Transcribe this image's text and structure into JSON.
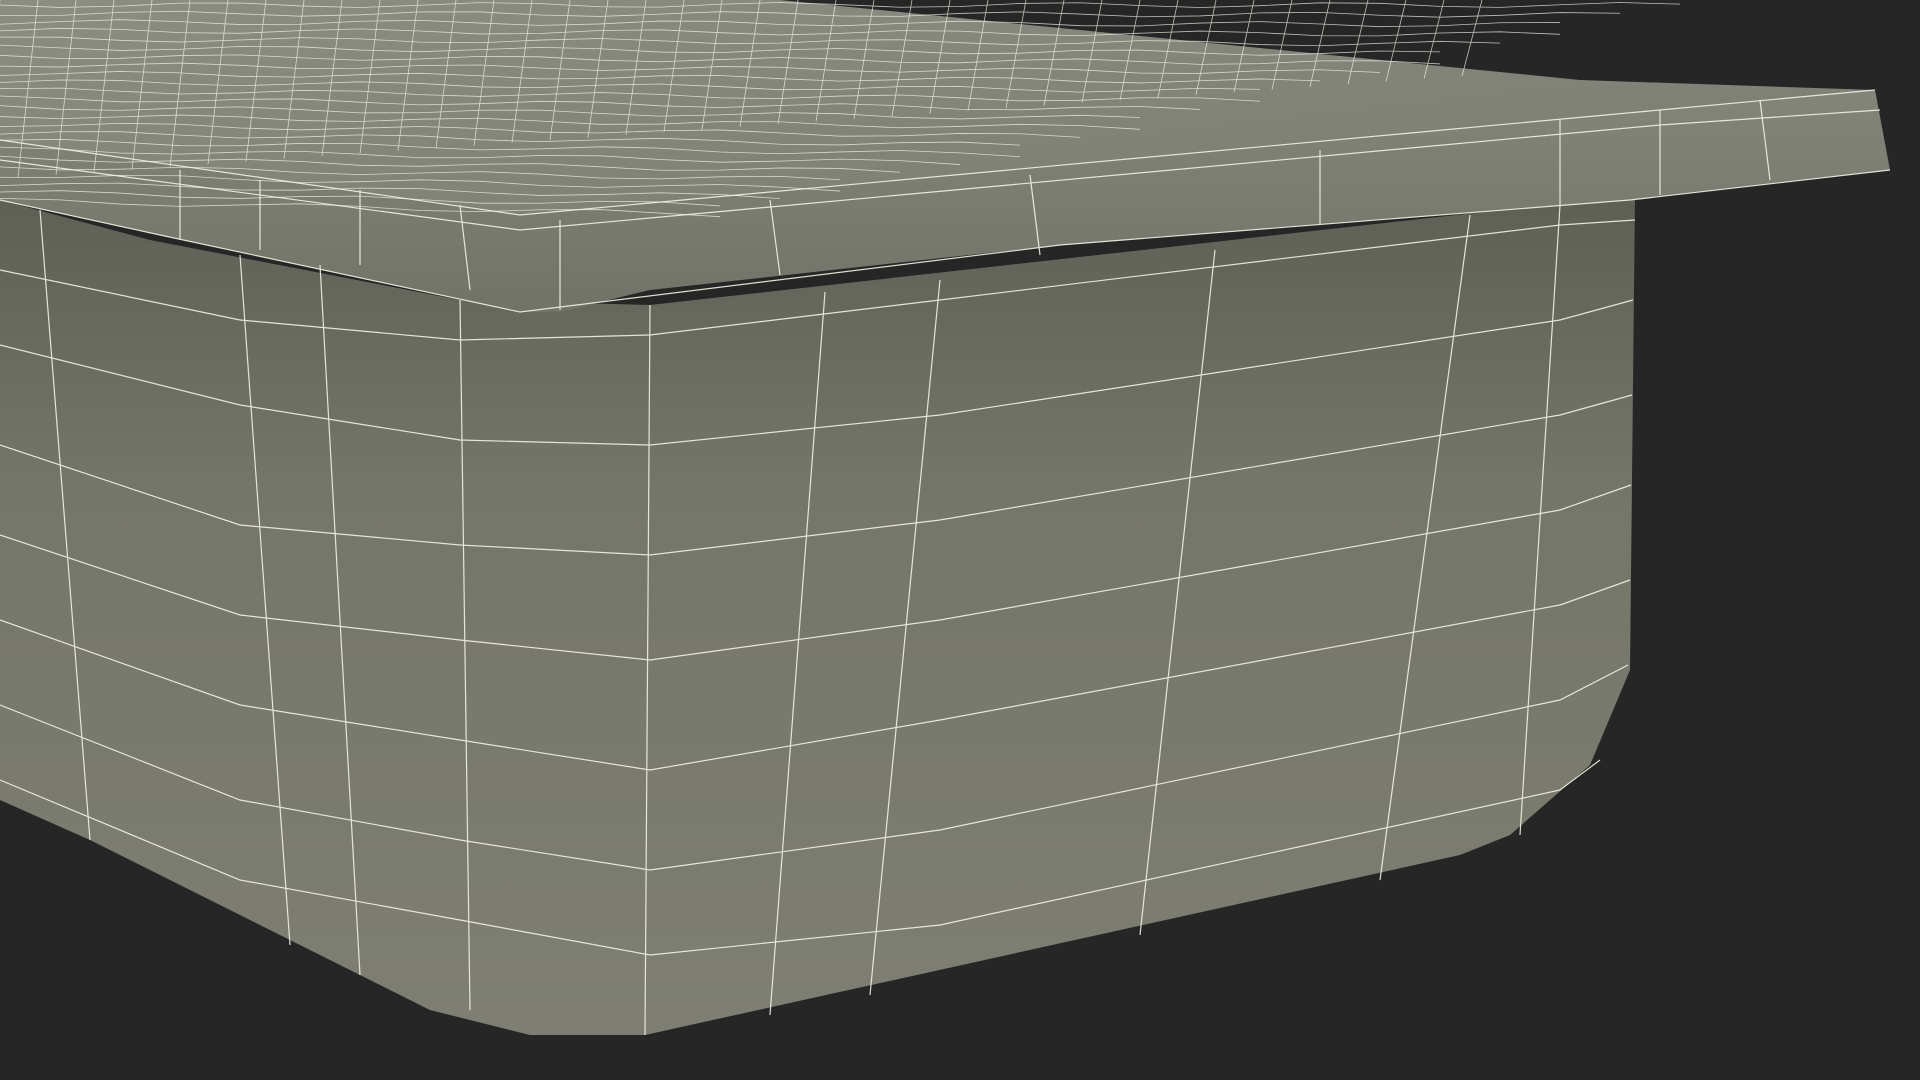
{
  "scene": {
    "subject": "wireframe-tray-model",
    "colors": {
      "background": "#262626",
      "surface": "#7a7b6e",
      "surface_dark": "#5c5d53",
      "wire": "#f2f2e4"
    }
  }
}
